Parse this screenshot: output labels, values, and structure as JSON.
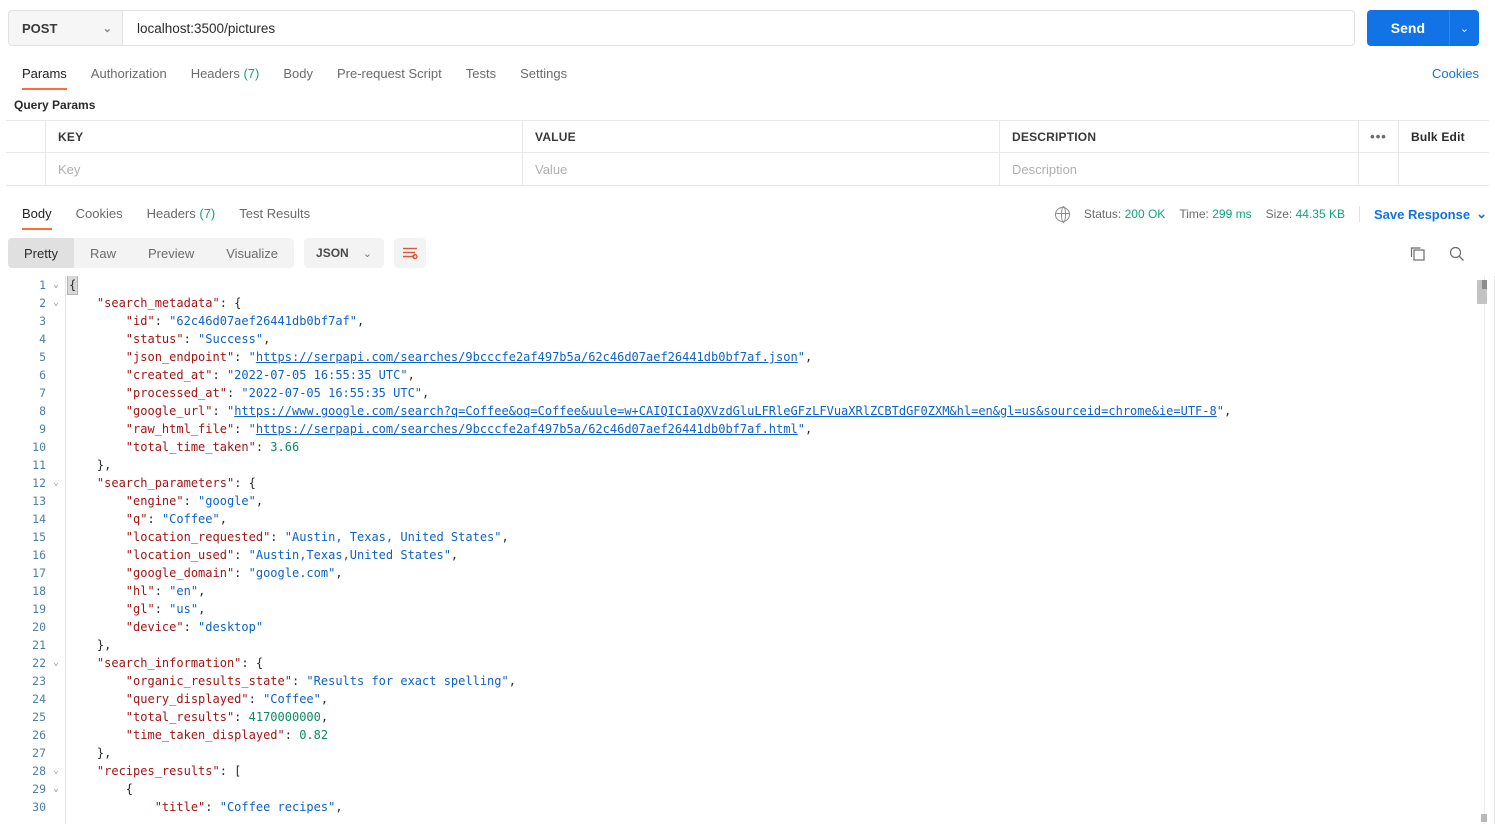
{
  "request": {
    "method": "POST",
    "method_caret": "⌄",
    "url": "localhost:3500/pictures",
    "send_label": "Send",
    "send_caret": "⌄",
    "tabs": [
      {
        "label": "Params",
        "count": "",
        "active": true
      },
      {
        "label": "Authorization",
        "count": "",
        "active": false
      },
      {
        "label": "Headers",
        "count": "(7)",
        "active": false
      },
      {
        "label": "Body",
        "count": "",
        "active": false
      },
      {
        "label": "Pre-request Script",
        "count": "",
        "active": false
      },
      {
        "label": "Tests",
        "count": "",
        "active": false
      },
      {
        "label": "Settings",
        "count": "",
        "active": false
      }
    ],
    "cookies_link": "Cookies",
    "query_params_label": "Query Params",
    "table": {
      "headers": {
        "key": "KEY",
        "value": "VALUE",
        "description": "DESCRIPTION"
      },
      "dots": "•••",
      "bulk_edit": "Bulk Edit",
      "row_placeholders": {
        "key": "Key",
        "value": "Value",
        "description": "Description"
      }
    }
  },
  "response": {
    "tabs": [
      {
        "label": "Body",
        "count": "",
        "active": true
      },
      {
        "label": "Cookies",
        "count": "",
        "active": false
      },
      {
        "label": "Headers",
        "count": "(7)",
        "active": false
      },
      {
        "label": "Test Results",
        "count": "",
        "active": false
      }
    ],
    "meta": {
      "status_label": "Status:",
      "status_value": "200 OK",
      "time_label": "Time:",
      "time_value": "299 ms",
      "size_label": "Size:",
      "size_value": "44.35 KB",
      "save_response": "Save Response",
      "save_caret": "⌄"
    },
    "view_modes": [
      {
        "label": "Pretty",
        "active": true
      },
      {
        "label": "Raw",
        "active": false
      },
      {
        "label": "Preview",
        "active": false
      },
      {
        "label": "Visualize",
        "active": false
      }
    ],
    "format": "JSON",
    "format_caret": "⌄"
  },
  "colors": {
    "accent": "#ff6c37",
    "link": "#1173e6",
    "green": "#10a37f",
    "json_string": "#0f62c7",
    "json_key": "#a31515",
    "json_number": "#0a8a5f"
  },
  "body_json": {
    "lines": [
      {
        "n": 1,
        "fold": "⌄",
        "indent": 0,
        "tokens": [
          {
            "t": "cursor",
            "v": "{"
          }
        ]
      },
      {
        "n": 2,
        "fold": "⌄",
        "indent": 1,
        "tokens": [
          {
            "t": "k",
            "v": "\"search_metadata\""
          },
          {
            "t": "p",
            "v": ": {"
          }
        ]
      },
      {
        "n": 3,
        "fold": "",
        "indent": 2,
        "tokens": [
          {
            "t": "k",
            "v": "\"id\""
          },
          {
            "t": "p",
            "v": ": "
          },
          {
            "t": "s",
            "v": "\"62c46d07aef26441db0bf7af\""
          },
          {
            "t": "p",
            "v": ","
          }
        ]
      },
      {
        "n": 4,
        "fold": "",
        "indent": 2,
        "tokens": [
          {
            "t": "k",
            "v": "\"status\""
          },
          {
            "t": "p",
            "v": ": "
          },
          {
            "t": "s",
            "v": "\"Success\""
          },
          {
            "t": "p",
            "v": ","
          }
        ]
      },
      {
        "n": 5,
        "fold": "",
        "indent": 2,
        "tokens": [
          {
            "t": "k",
            "v": "\"json_endpoint\""
          },
          {
            "t": "p",
            "v": ": "
          },
          {
            "t": "s",
            "v": "\""
          },
          {
            "t": "lnk",
            "v": "https://serpapi.com/searches/9bcccfe2af497b5a/62c46d07aef26441db0bf7af.json"
          },
          {
            "t": "s",
            "v": "\""
          },
          {
            "t": "p",
            "v": ","
          }
        ]
      },
      {
        "n": 6,
        "fold": "",
        "indent": 2,
        "tokens": [
          {
            "t": "k",
            "v": "\"created_at\""
          },
          {
            "t": "p",
            "v": ": "
          },
          {
            "t": "s",
            "v": "\"2022-07-05 16:55:35 UTC\""
          },
          {
            "t": "p",
            "v": ","
          }
        ]
      },
      {
        "n": 7,
        "fold": "",
        "indent": 2,
        "tokens": [
          {
            "t": "k",
            "v": "\"processed_at\""
          },
          {
            "t": "p",
            "v": ": "
          },
          {
            "t": "s",
            "v": "\"2022-07-05 16:55:35 UTC\""
          },
          {
            "t": "p",
            "v": ","
          }
        ]
      },
      {
        "n": 8,
        "fold": "",
        "indent": 2,
        "tokens": [
          {
            "t": "k",
            "v": "\"google_url\""
          },
          {
            "t": "p",
            "v": ": "
          },
          {
            "t": "s",
            "v": "\""
          },
          {
            "t": "lnk",
            "v": "https://www.google.com/search?q=Coffee&oq=Coffee&uule=w+CAIQICIaQXVzdGluLFRleGFzLFVuaXRlZCBTdGF0ZXM&hl=en&gl=us&sourceid=chrome&ie=UTF-8"
          },
          {
            "t": "s",
            "v": "\""
          },
          {
            "t": "p",
            "v": ","
          }
        ]
      },
      {
        "n": 9,
        "fold": "",
        "indent": 2,
        "tokens": [
          {
            "t": "k",
            "v": "\"raw_html_file\""
          },
          {
            "t": "p",
            "v": ": "
          },
          {
            "t": "s",
            "v": "\""
          },
          {
            "t": "lnk",
            "v": "https://serpapi.com/searches/9bcccfe2af497b5a/62c46d07aef26441db0bf7af.html"
          },
          {
            "t": "s",
            "v": "\""
          },
          {
            "t": "p",
            "v": ","
          }
        ]
      },
      {
        "n": 10,
        "fold": "",
        "indent": 2,
        "tokens": [
          {
            "t": "k",
            "v": "\"total_time_taken\""
          },
          {
            "t": "p",
            "v": ": "
          },
          {
            "t": "n",
            "v": "3.66"
          }
        ]
      },
      {
        "n": 11,
        "fold": "",
        "indent": 1,
        "tokens": [
          {
            "t": "p",
            "v": "},"
          }
        ]
      },
      {
        "n": 12,
        "fold": "⌄",
        "indent": 1,
        "tokens": [
          {
            "t": "k",
            "v": "\"search_parameters\""
          },
          {
            "t": "p",
            "v": ": {"
          }
        ]
      },
      {
        "n": 13,
        "fold": "",
        "indent": 2,
        "tokens": [
          {
            "t": "k",
            "v": "\"engine\""
          },
          {
            "t": "p",
            "v": ": "
          },
          {
            "t": "s",
            "v": "\"google\""
          },
          {
            "t": "p",
            "v": ","
          }
        ]
      },
      {
        "n": 14,
        "fold": "",
        "indent": 2,
        "tokens": [
          {
            "t": "k",
            "v": "\"q\""
          },
          {
            "t": "p",
            "v": ": "
          },
          {
            "t": "s",
            "v": "\"Coffee\""
          },
          {
            "t": "p",
            "v": ","
          }
        ]
      },
      {
        "n": 15,
        "fold": "",
        "indent": 2,
        "tokens": [
          {
            "t": "k",
            "v": "\"location_requested\""
          },
          {
            "t": "p",
            "v": ": "
          },
          {
            "t": "s",
            "v": "\"Austin, Texas, United States\""
          },
          {
            "t": "p",
            "v": ","
          }
        ]
      },
      {
        "n": 16,
        "fold": "",
        "indent": 2,
        "tokens": [
          {
            "t": "k",
            "v": "\"location_used\""
          },
          {
            "t": "p",
            "v": ": "
          },
          {
            "t": "s",
            "v": "\"Austin,Texas,United States\""
          },
          {
            "t": "p",
            "v": ","
          }
        ]
      },
      {
        "n": 17,
        "fold": "",
        "indent": 2,
        "tokens": [
          {
            "t": "k",
            "v": "\"google_domain\""
          },
          {
            "t": "p",
            "v": ": "
          },
          {
            "t": "s",
            "v": "\"google.com\""
          },
          {
            "t": "p",
            "v": ","
          }
        ]
      },
      {
        "n": 18,
        "fold": "",
        "indent": 2,
        "tokens": [
          {
            "t": "k",
            "v": "\"hl\""
          },
          {
            "t": "p",
            "v": ": "
          },
          {
            "t": "s",
            "v": "\"en\""
          },
          {
            "t": "p",
            "v": ","
          }
        ]
      },
      {
        "n": 19,
        "fold": "",
        "indent": 2,
        "tokens": [
          {
            "t": "k",
            "v": "\"gl\""
          },
          {
            "t": "p",
            "v": ": "
          },
          {
            "t": "s",
            "v": "\"us\""
          },
          {
            "t": "p",
            "v": ","
          }
        ]
      },
      {
        "n": 20,
        "fold": "",
        "indent": 2,
        "tokens": [
          {
            "t": "k",
            "v": "\"device\""
          },
          {
            "t": "p",
            "v": ": "
          },
          {
            "t": "s",
            "v": "\"desktop\""
          }
        ]
      },
      {
        "n": 21,
        "fold": "",
        "indent": 1,
        "tokens": [
          {
            "t": "p",
            "v": "},"
          }
        ]
      },
      {
        "n": 22,
        "fold": "⌄",
        "indent": 1,
        "tokens": [
          {
            "t": "k",
            "v": "\"search_information\""
          },
          {
            "t": "p",
            "v": ": {"
          }
        ]
      },
      {
        "n": 23,
        "fold": "",
        "indent": 2,
        "tokens": [
          {
            "t": "k",
            "v": "\"organic_results_state\""
          },
          {
            "t": "p",
            "v": ": "
          },
          {
            "t": "s",
            "v": "\"Results for exact spelling\""
          },
          {
            "t": "p",
            "v": ","
          }
        ]
      },
      {
        "n": 24,
        "fold": "",
        "indent": 2,
        "tokens": [
          {
            "t": "k",
            "v": "\"query_displayed\""
          },
          {
            "t": "p",
            "v": ": "
          },
          {
            "t": "s",
            "v": "\"Coffee\""
          },
          {
            "t": "p",
            "v": ","
          }
        ]
      },
      {
        "n": 25,
        "fold": "",
        "indent": 2,
        "tokens": [
          {
            "t": "k",
            "v": "\"total_results\""
          },
          {
            "t": "p",
            "v": ": "
          },
          {
            "t": "n",
            "v": "4170000000"
          },
          {
            "t": "p",
            "v": ","
          }
        ]
      },
      {
        "n": 26,
        "fold": "",
        "indent": 2,
        "tokens": [
          {
            "t": "k",
            "v": "\"time_taken_displayed\""
          },
          {
            "t": "p",
            "v": ": "
          },
          {
            "t": "n",
            "v": "0.82"
          }
        ]
      },
      {
        "n": 27,
        "fold": "",
        "indent": 1,
        "tokens": [
          {
            "t": "p",
            "v": "},"
          }
        ]
      },
      {
        "n": 28,
        "fold": "⌄",
        "indent": 1,
        "tokens": [
          {
            "t": "k",
            "v": "\"recipes_results\""
          },
          {
            "t": "p",
            "v": ": ["
          }
        ]
      },
      {
        "n": 29,
        "fold": "⌄",
        "indent": 2,
        "tokens": [
          {
            "t": "p",
            "v": "{"
          }
        ]
      },
      {
        "n": 30,
        "fold": "",
        "indent": 3,
        "tokens": [
          {
            "t": "k",
            "v": "\"title\""
          },
          {
            "t": "p",
            "v": ": "
          },
          {
            "t": "s",
            "v": "\"Coffee recipes\""
          },
          {
            "t": "p",
            "v": ","
          }
        ]
      }
    ]
  }
}
